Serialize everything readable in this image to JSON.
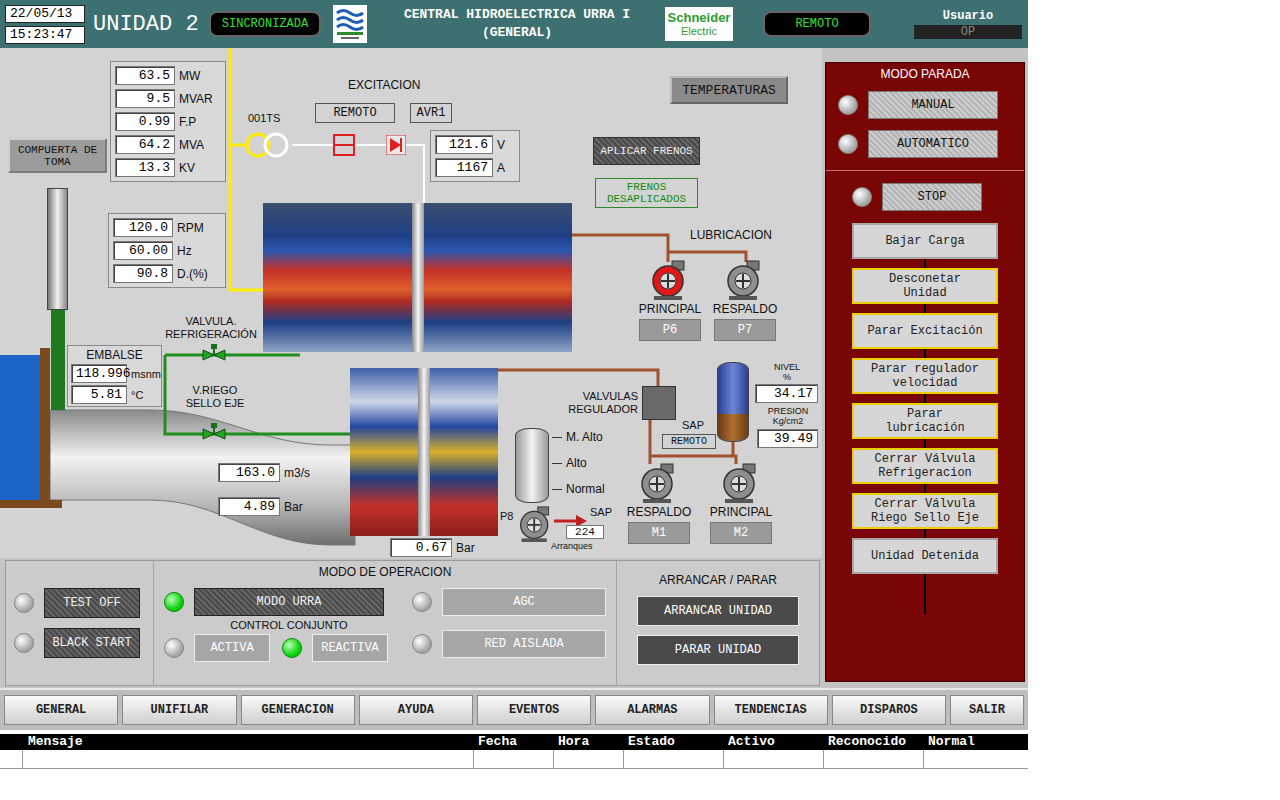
{
  "header": {
    "date": "22/05/13",
    "time": "15:23:47",
    "unit": "UNIDAD 2",
    "sync_status": "SINCRONIZADA",
    "title": "CENTRAL HIDROELECTRICA URRA I",
    "subtitle": "(GENERAL)",
    "brand": [
      "Schneider",
      "Electric"
    ],
    "control_mode": "REMOTO",
    "user_label": "Usuario",
    "user": "OP"
  },
  "generation": [
    {
      "value": "63.5",
      "unit": "MW"
    },
    {
      "value": "9.5",
      "unit": "MVAR"
    },
    {
      "value": "0.99",
      "unit": "F.P"
    },
    {
      "value": "64.2",
      "unit": "MVA"
    },
    {
      "value": "13.3",
      "unit": "KV"
    }
  ],
  "speed": [
    {
      "value": "120.0",
      "unit": "RPM"
    },
    {
      "value": "60.00",
      "unit": "Hz"
    },
    {
      "value": "90.8",
      "unit": "D.(%)"
    }
  ],
  "intake_gate_button": "COMPUERTA DE TOMA",
  "transformer": "001TS",
  "excitation": {
    "title": "EXCITACION",
    "mode": "REMOTO",
    "regulator": "AVR1",
    "readings": [
      {
        "value": "121.6",
        "unit": "V"
      },
      {
        "value": "1167",
        "unit": "A"
      }
    ]
  },
  "temperatures_button": "TEMPERATURAS",
  "brakes": {
    "button": "APLICAR FRENOS",
    "status": "FRENOS DESAPLICADOS"
  },
  "lubrication": {
    "title": "LUBRICACION",
    "pumps": [
      {
        "label": "PRINCIPAL",
        "tag": "P6",
        "running": true
      },
      {
        "label": "RESPALDO",
        "tag": "P7",
        "running": false
      }
    ]
  },
  "reservoir": {
    "title": "EMBALSE",
    "level": "118.996",
    "level_unit": "msnm",
    "temperature": "5.81",
    "temperature_unit": "°C"
  },
  "valves": [
    {
      "label_lines": [
        "VALVULA.",
        "REFRIGERACIÓN"
      ],
      "open": true
    },
    {
      "label_lines": [
        "V.RIEGO",
        "SELLO EJE"
      ],
      "open": true
    }
  ],
  "penstock": {
    "flow": "163.0",
    "flow_unit": "m3/s",
    "pressure": "4.89",
    "pressure_unit": "Bar"
  },
  "draft_tube": {
    "pressure": "0.67",
    "unit": "Bar"
  },
  "governor": {
    "valves_label_lines": [
      "VALVULAS",
      "REGULADOR"
    ],
    "sap": {
      "label": "SAP",
      "mode": "REMOTO",
      "level_label_lines": [
        "NIVEL",
        "%"
      ],
      "level": "34.17",
      "tank_level": 0.34,
      "pressure_label_lines": [
        "PRESION",
        "Kg/cm2"
      ],
      "pressure": "39.49"
    },
    "pumps": [
      {
        "label": "RESPALDO",
        "tag": "M1",
        "running": false
      },
      {
        "label": "PRINCIPAL",
        "tag": "M2",
        "running": false
      }
    ]
  },
  "sump": {
    "levels": [
      "M. Alto",
      "Alto",
      "Normal"
    ],
    "pump": "P8",
    "running": false,
    "destination": "SAP",
    "starts": "224",
    "starts_label": "Arranques"
  },
  "stop_mode": {
    "title": "MODO PARADA",
    "options": [
      {
        "label": "MANUAL",
        "selected": false
      },
      {
        "label": "AUTOMATICO",
        "selected": false
      }
    ],
    "stop": {
      "label": "STOP",
      "on": false
    },
    "steps": [
      {
        "label_lines": [
          "Bajar Carga"
        ],
        "highlighted": false
      },
      {
        "label_lines": [
          "Desconetar",
          "Unidad"
        ],
        "highlighted": true
      },
      {
        "label_lines": [
          "Parar Excitación"
        ],
        "highlighted": true
      },
      {
        "label_lines": [
          "Parar regulador",
          "velocidad"
        ],
        "highlighted": true
      },
      {
        "label_lines": [
          "Parar",
          "lubricación"
        ],
        "highlighted": true
      },
      {
        "label_lines": [
          "Cerrar Válvula",
          "Refrigeracion"
        ],
        "highlighted": true
      },
      {
        "label_lines": [
          "Cerrar Válvula",
          "Riego Sello Eje"
        ],
        "highlighted": true
      },
      {
        "label_lines": [
          "Unidad Detenida"
        ],
        "highlighted": false
      }
    ]
  },
  "operation_mode": {
    "title": "MODO DE OPERACION",
    "test": [
      {
        "label": "TEST OFF",
        "on": false
      },
      {
        "label": "BLACK START",
        "on": false
      }
    ],
    "main_mode": {
      "label": "MODO URRA",
      "on": true
    },
    "joint_control": {
      "label": "CONTROL CONJUNTO",
      "options": [
        {
          "label": "ACTIVA",
          "on": false
        },
        {
          "label": "REACTIVA",
          "on": true
        }
      ]
    },
    "grid_modes": [
      {
        "label": "AGC",
        "on": false
      },
      {
        "label": "RED AISLADA",
        "on": false
      }
    ],
    "start_stop": {
      "title": "ARRANCAR / PARAR",
      "buttons": [
        "ARRANCAR UNIDAD",
        "PARAR UNIDAD"
      ]
    }
  },
  "nav": [
    "GENERAL",
    "UNIFILAR",
    "GENERACION",
    "AYUDA",
    "EVENTOS",
    "ALARMAS",
    "TENDENCIAS",
    "DISPAROS",
    "SALIR"
  ],
  "events_table": {
    "columns": [
      "Mensaje",
      "Fecha",
      "Hora",
      "Estado",
      "Activo",
      "Reconocido",
      "Normal"
    ],
    "rows": []
  }
}
